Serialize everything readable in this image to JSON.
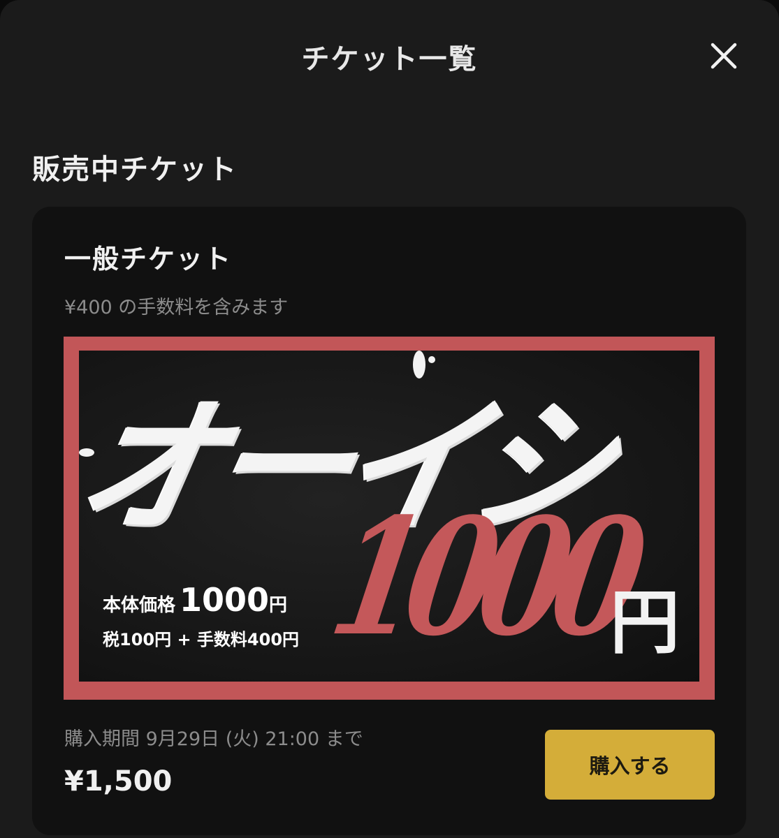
{
  "header": {
    "title": "チケット一覧",
    "close_icon": "close-icon"
  },
  "section": {
    "title": "販売中チケット"
  },
  "ticket": {
    "name": "一般チケット",
    "fee_note": "¥400 の手数料を含みます",
    "banner": {
      "headline": "オーイシ",
      "price_big": "1000",
      "price_big_unit": "円",
      "base_label": "本体価格",
      "base_price": "1000",
      "base_unit": "円",
      "breakdown": "税100円 + 手数料400円",
      "frame_color": "#c25658"
    },
    "period": "購入期間 9月29日 (火) 21:00 まで",
    "price": "¥1,500",
    "buy_label": "購入する",
    "buy_color": "#d4ad39"
  }
}
